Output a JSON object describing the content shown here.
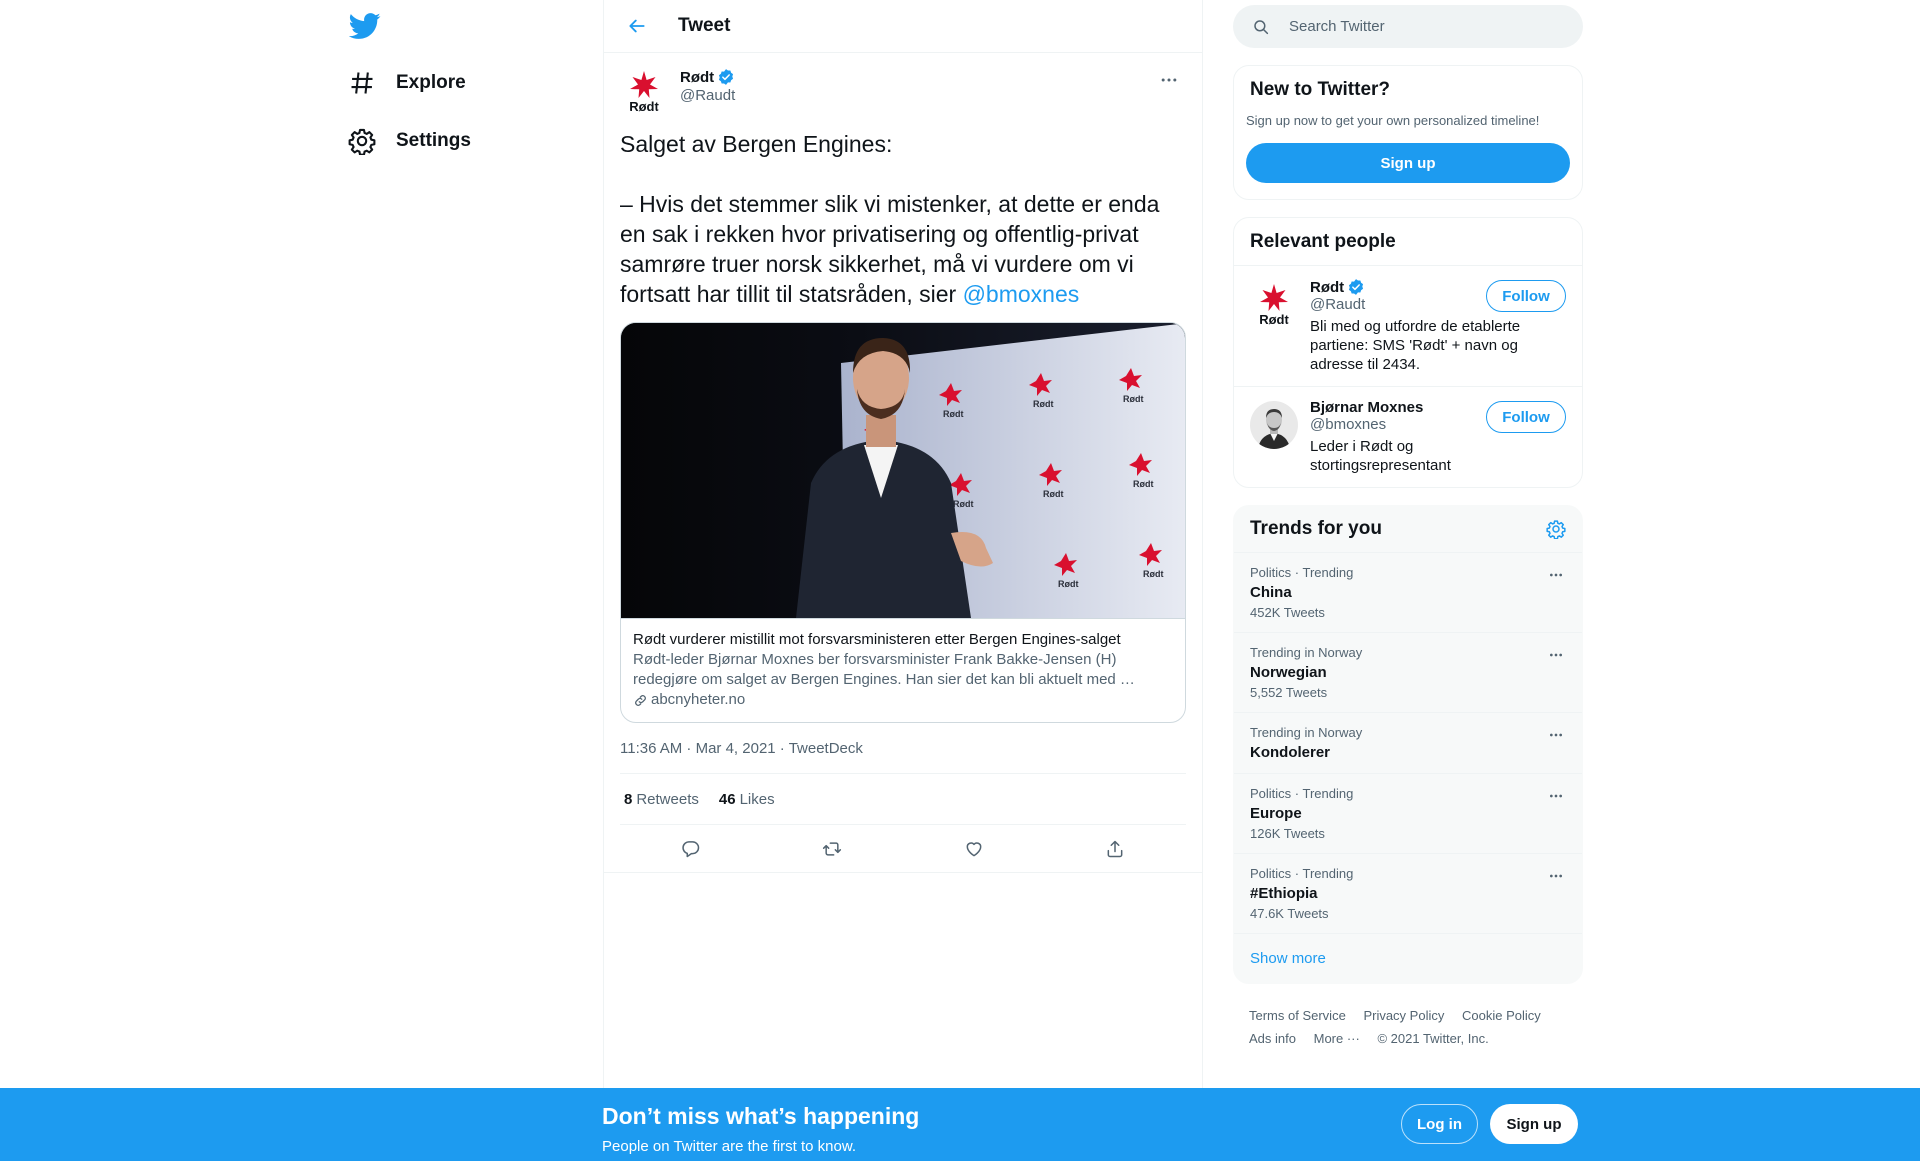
{
  "nav": {
    "explore_label": "Explore",
    "settings_label": "Settings"
  },
  "header": {
    "title": "Tweet"
  },
  "tweet": {
    "author_name": "Rødt",
    "author_handle": "@Raudt",
    "avatar_text": "Rødt",
    "text_line1": "Salget av Bergen Engines:",
    "text_body": "– Hvis det stemmer slik vi mistenker, at dette er enda en sak i rekken hvor privatisering og offentlig-privat samrøre truer norsk sikkerhet, må vi vurdere om vi fortsatt har tillit til statsråden, sier ",
    "mention": "@bmoxnes",
    "card": {
      "title": "Rødt vurderer mistillit mot forsvarsministeren etter Bergen Engines-salget",
      "description": "Rødt-leder Bjørnar Moxnes ber forsvarsminister Frank Bakke-Jensen (H) redegjøre om salget av Bergen Engines. Han sier det kan bli aktuelt med …",
      "domain": "abcnyheter.no",
      "backdrop_text": "Rødt"
    },
    "timestamp": "11:36 AM · Mar 4, 2021 · TweetDeck",
    "retweets_count": "8",
    "retweets_label": "Retweets",
    "likes_count": "46",
    "likes_label": "Likes"
  },
  "search": {
    "placeholder": "Search Twitter"
  },
  "new_to_twitter": {
    "title": "New to Twitter?",
    "subtitle": "Sign up now to get your own personalized timeline!",
    "signup_label": "Sign up"
  },
  "relevant_people": {
    "title": "Relevant people",
    "people": [
      {
        "name": "Rødt",
        "handle": "@Raudt",
        "bio": "Bli med og utfordre de etablerte partiene: SMS 'Rødt' + navn og adresse til 2434.",
        "follow_label": "Follow",
        "verified": true,
        "avatar_text": "Rødt"
      },
      {
        "name": "Bjørnar Moxnes",
        "handle": "@bmoxnes",
        "bio": "Leder i Rødt og stortingsrepresentant",
        "follow_label": "Follow",
        "verified": false
      }
    ]
  },
  "trends": {
    "title": "Trends for you",
    "items": [
      {
        "meta": "Politics · Trending",
        "name": "China",
        "count": "452K Tweets"
      },
      {
        "meta": "Trending in Norway",
        "name": "Norwegian",
        "count": "5,552 Tweets"
      },
      {
        "meta": "Trending in Norway",
        "name": "Kondolerer",
        "count": ""
      },
      {
        "meta": "Politics · Trending",
        "name": "Europe",
        "count": "126K Tweets"
      },
      {
        "meta": "Politics · Trending",
        "name": "#Ethiopia",
        "count": "47.6K Tweets"
      }
    ],
    "show_more": "Show more"
  },
  "footer": {
    "terms": "Terms of Service",
    "privacy": "Privacy Policy",
    "cookie": "Cookie Policy",
    "ads": "Ads info",
    "more": "More ···",
    "copyright": "© 2021 Twitter, Inc."
  },
  "bottom_bar": {
    "title": "Don’t miss what’s happening",
    "subtitle": "People on Twitter are the first to know.",
    "login_label": "Log in",
    "signup_label": "Sign up"
  },
  "colors": {
    "accent": "#1d9bf0",
    "party_red": "#d9102f"
  }
}
